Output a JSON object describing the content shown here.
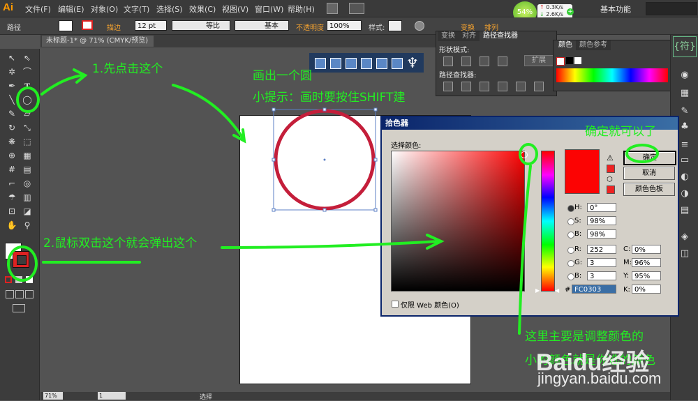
{
  "app": {
    "logo": "Ai"
  },
  "menu": {
    "items": [
      "文件(F)",
      "编辑(E)",
      "对象(O)",
      "文字(T)",
      "选择(S)",
      "效果(C)",
      "视图(V)",
      "窗口(W)",
      "帮助(H)"
    ],
    "workspace": "基本功能"
  },
  "network": {
    "percent": "54%",
    "up": "0.3K/s",
    "down": "2.6K/s"
  },
  "control_bar": {
    "object_label": "路径",
    "stroke_label": "描边",
    "stroke_weight": "12 pt",
    "profile1": "等比",
    "profile2": "基本",
    "opacity_label": "不透明度",
    "opacity_value": "100%",
    "style_label": "样式:",
    "transform_label": "变换",
    "arrange_label": "排列"
  },
  "document": {
    "tab": "未标题-1* @ 71% (CMYK/预览)"
  },
  "pathfinder": {
    "tabs": [
      "变换",
      "对齐",
      "路径查找器"
    ],
    "shape_modes": "形状模式:",
    "expand": "扩展",
    "pathfinders": "路径查找器:"
  },
  "color_panel": {
    "tabs": [
      "颜色",
      "颜色参考"
    ]
  },
  "picker": {
    "title": "拾色器",
    "select_color": "选择颜色:",
    "ok": "确定",
    "cancel": "取消",
    "swatches": "颜色色板",
    "web_only": "仅限 Web 颜色(O)",
    "fields": {
      "H_label": "H:",
      "H": "0°",
      "S_label": "S:",
      "S": "98%",
      "Bv_label": "B:",
      "Bv": "98%",
      "R_label": "R:",
      "R": "252",
      "G_label": "G:",
      "G": "3",
      "B_label": "B:",
      "B": "3",
      "hex": "FC0303",
      "C_label": "C:",
      "C": "0%",
      "M_label": "M:",
      "M": "96%",
      "Y_label": "Y:",
      "Y": "95%",
      "K_label": "K:",
      "K": "0%"
    },
    "color": "#fc0303"
  },
  "annotations": {
    "step1": "1.先点击这个",
    "draw_circle": "画出一个圆",
    "tip": "小提示：画时要按住SHIFT建",
    "confirm": "确定就可以了",
    "step2": "2.鼠标双击这个就会弹出这个",
    "adjust1": "这里主要是调整颜色的",
    "adjust2": "小的颜色就是你选的颜色"
  },
  "status": {
    "zoom": "71%",
    "page": "1",
    "tool": "选择"
  },
  "watermark": {
    "brand": "Baidu经验",
    "url": "jingyan.baidu.com"
  },
  "colors": {
    "annotation": "#22ee22",
    "circle_stroke": "#c41e3a",
    "accent": "#ff9a00"
  }
}
